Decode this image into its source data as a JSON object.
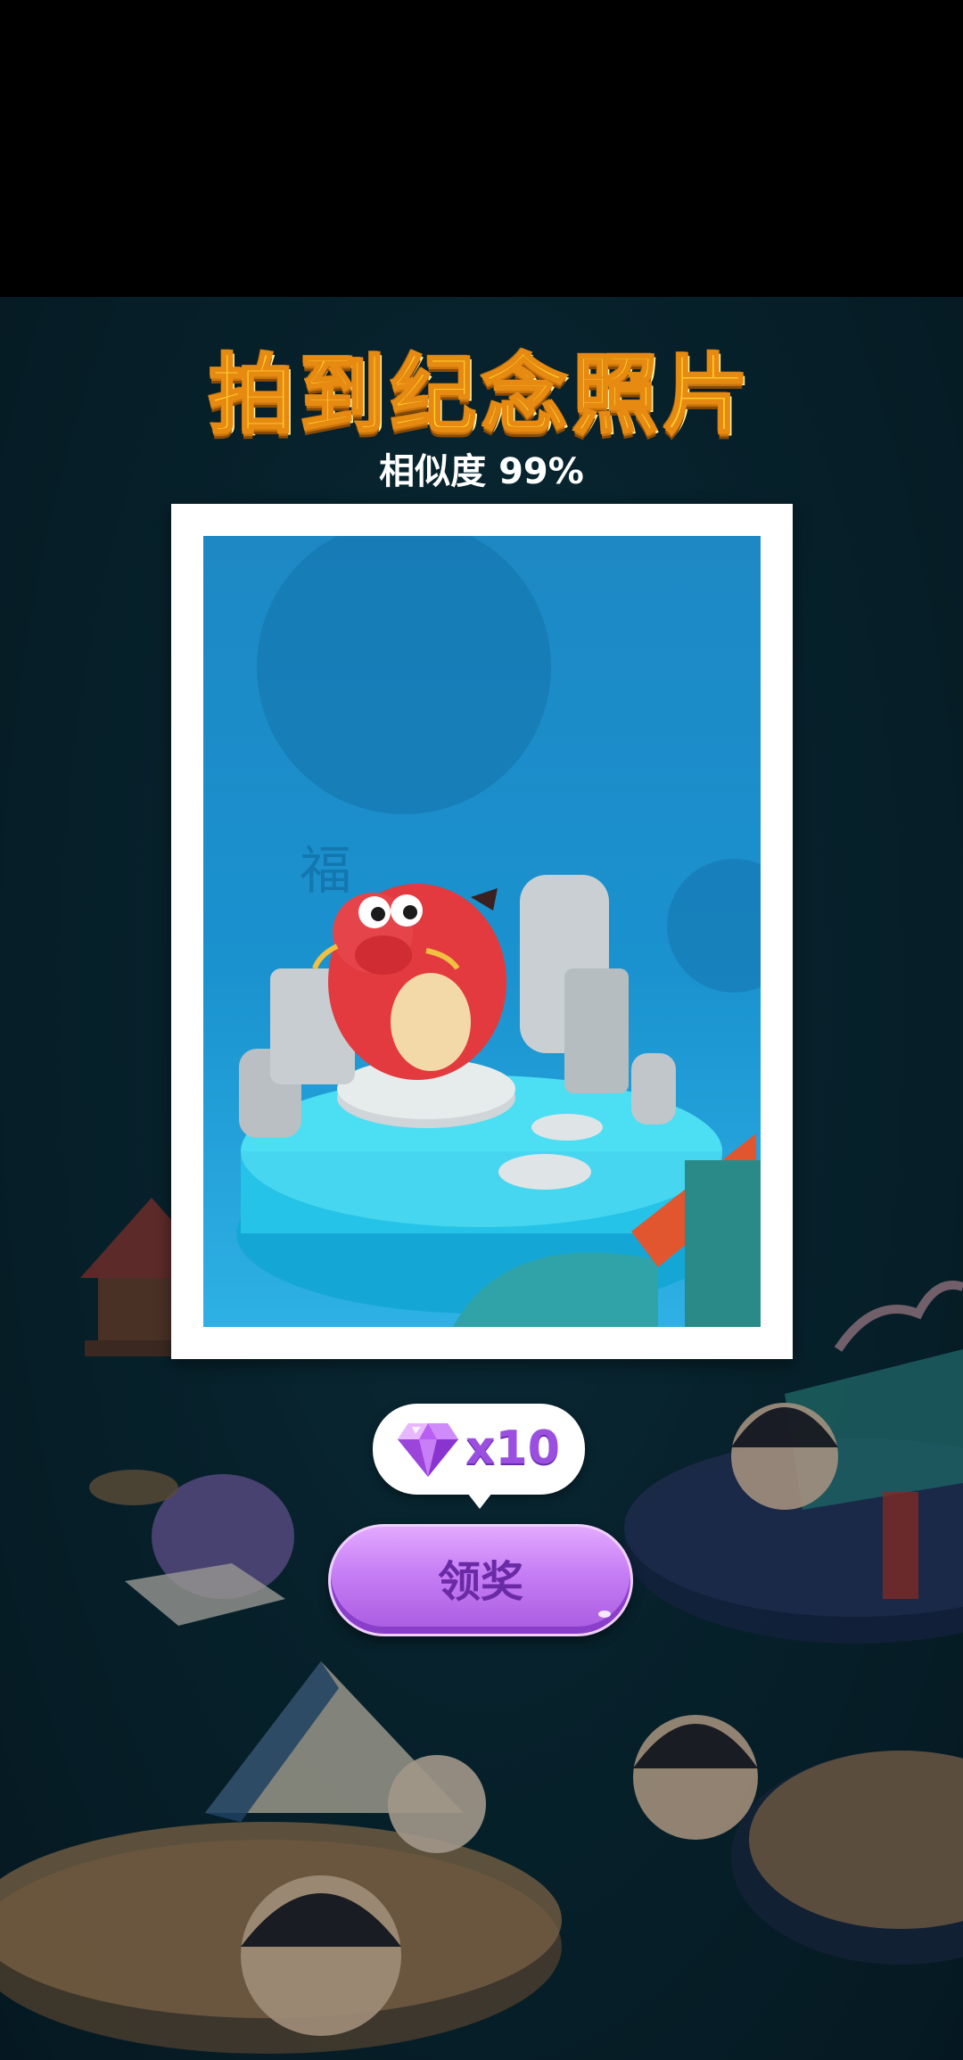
{
  "popup": {
    "title": "拍到纪念照片",
    "similarity": "相似度 99%"
  },
  "photo": {
    "fu_character": "福"
  },
  "reward": {
    "icon": "gem-icon",
    "count": "x10"
  },
  "claim_button": {
    "label": "领奖"
  },
  "colors": {
    "title": "#ffcf2e",
    "button": "#c57cf4",
    "gem": "#b85ef2",
    "photo_bg": "#1a92cf"
  }
}
